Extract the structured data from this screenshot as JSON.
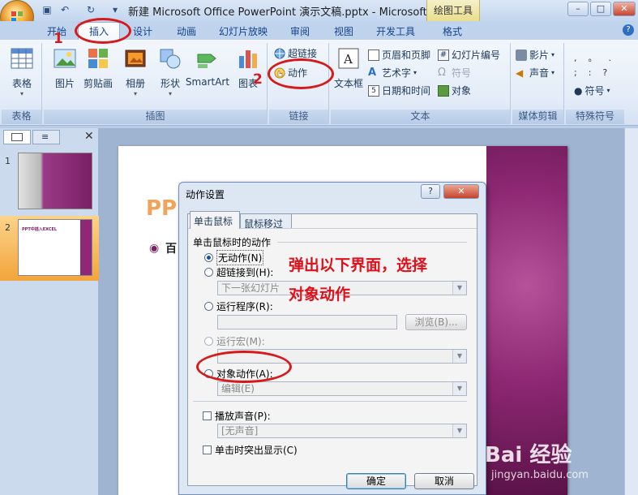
{
  "window": {
    "title": "新建 Microsoft Office PowerPoint 演示文稿.pptx - Microsoft ...",
    "context_tool": "绘图工具",
    "min": "–",
    "max": "□",
    "close": "✕"
  },
  "tabs": [
    "开始",
    "插入",
    "设计",
    "动画",
    "幻灯片放映",
    "审阅",
    "视图",
    "开发工具",
    "格式"
  ],
  "ribbon": {
    "table_group": {
      "table": "表格",
      "label": "表格"
    },
    "illustration_group": {
      "picture": "图片",
      "clipart": "剪贴画",
      "album": "相册",
      "shapes": "形状",
      "smartart": "SmartArt",
      "chart": "图表",
      "label": "插图"
    },
    "links_group": {
      "hyperlink": "超链接",
      "action": "动作",
      "label": "链接"
    },
    "text_group": {
      "textbox": "文本框",
      "header_footer": "页眉和页脚",
      "wordart": "艺术字",
      "datetime": "日期和时间",
      "slide_number": "幻灯片编号",
      "symbol": "符号",
      "object": "对象",
      "label": "文本"
    },
    "media_group": {
      "movie": "影片",
      "sound": "声音",
      "label": "媒体剪辑"
    },
    "special_group": {
      "symbol": "符号",
      "label": "特殊符号"
    }
  },
  "slide_pane": {
    "num1": "1",
    "num2": "2",
    "thumb2_title": "PPT中插入EXCEL"
  },
  "slide": {
    "title_fragment": "PP",
    "bullet_fragment": "百"
  },
  "dialog": {
    "title": "动作设置",
    "help": "?",
    "close": "✕",
    "tab_click": "单击鼠标",
    "tab_hover": "鼠标移过",
    "section": "单击鼠标时的动作",
    "opt_none": "无动作(N)",
    "opt_hyperlink": "超链接到(H):",
    "hyperlink_value": "下一张幻灯片",
    "opt_run_program": "运行程序(R):",
    "browse": "浏览(B)...",
    "opt_run_macro": "运行宏(M):",
    "opt_object_action": "对象动作(A):",
    "object_action_value": "编辑(E)",
    "play_sound": "播放声音(P):",
    "sound_value": "[无声音]",
    "highlight": "单击时突出显示(C)",
    "ok": "确定",
    "cancel": "取消"
  },
  "annotations": {
    "num1": "1",
    "num2": "2",
    "note_line1": "弹出以下界面，选择",
    "note_line2": "对象动作"
  },
  "watermark": {
    "main": "Bai 经验",
    "sub": "jingyan.baidu.com"
  },
  "colors": {
    "annotation_red": "#d7191c",
    "ribbon_blue": "#dbe7f6",
    "slide_purple": "#8e2874"
  }
}
